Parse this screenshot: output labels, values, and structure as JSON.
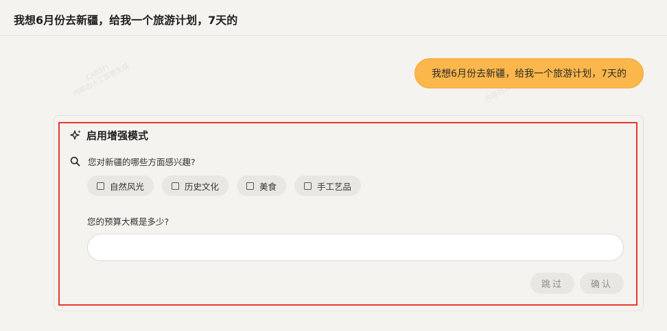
{
  "header": {
    "title": "我想6月份去新疆，给我一个旅游计划，7天的"
  },
  "chat": {
    "user_message": "我想6月份去新疆，给我一个旅游计划，7天的"
  },
  "watermark": {
    "brand": "CARSFI",
    "caption": "内容由人工智能生成"
  },
  "enhance": {
    "title": "启用增强模式",
    "icon": "sparkle-icon"
  },
  "question1": {
    "icon": "search-icon",
    "text": "您对新疆的哪些方面感兴趣?",
    "options": [
      {
        "label": "自然风光",
        "checked": false
      },
      {
        "label": "历史文化",
        "checked": false
      },
      {
        "label": "美食",
        "checked": false
      },
      {
        "label": "手工艺品",
        "checked": false
      }
    ]
  },
  "question2": {
    "text": "您的预算大概是多少?",
    "value": "",
    "placeholder": ""
  },
  "actions": {
    "skip_label": "跳过",
    "confirm_label": "确认"
  },
  "colors": {
    "background": "#f4f3ef",
    "bubble": "#fbb74b",
    "highlight": "#e8362c",
    "chip": "#e8e7e2"
  }
}
